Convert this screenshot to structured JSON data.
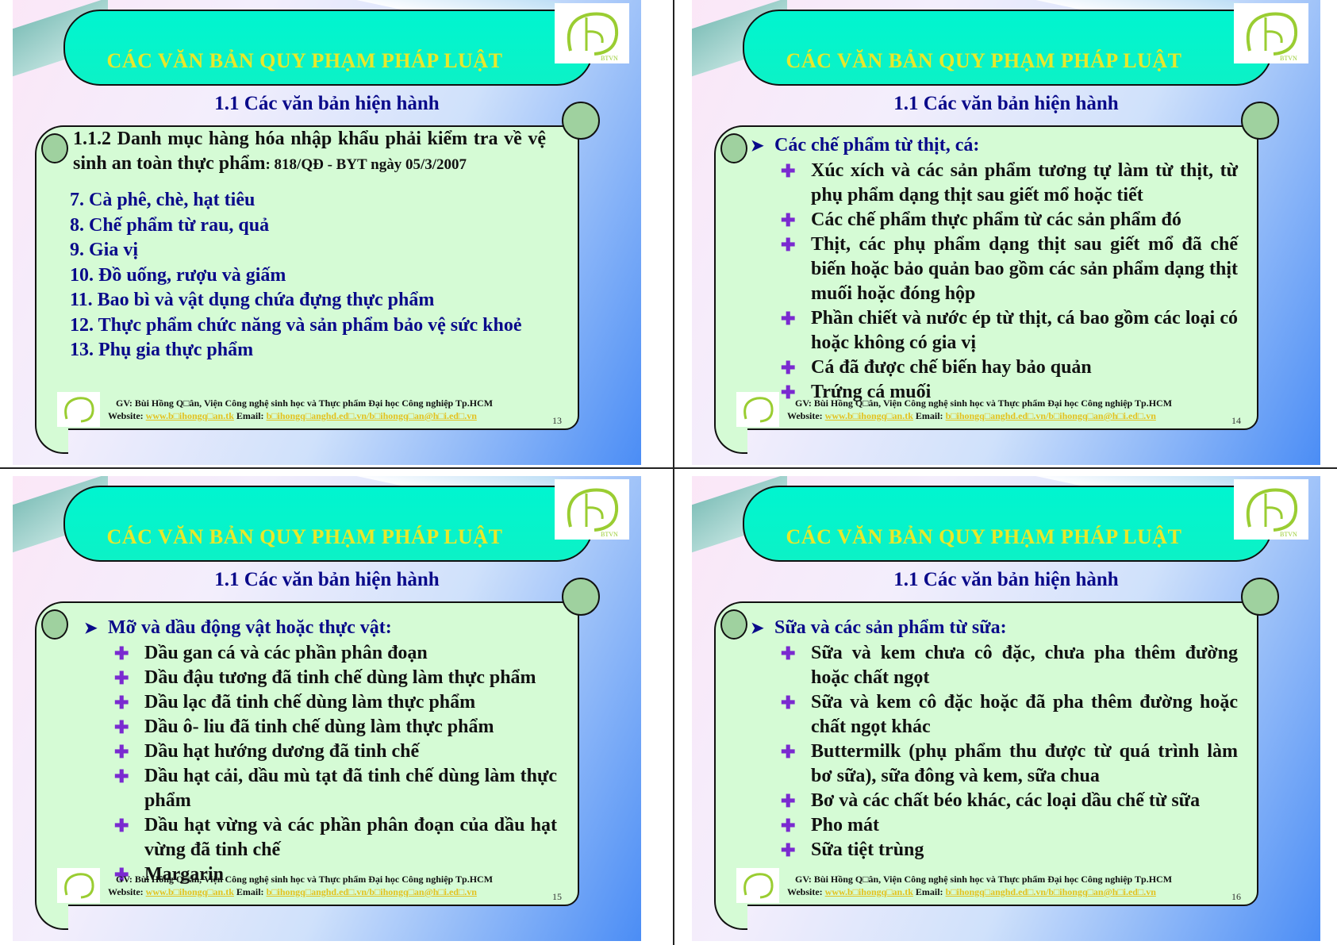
{
  "slides": [
    {
      "title": "CÁC VĂN BẢN QUY PHẠM PHÁP LUẬT",
      "subtitle": "1.1 Các văn bản hiện hành",
      "heading_main": "1.1.2  Danh mục hàng hóa nhập khẩu phải kiểm tra về vệ sinh an toàn thực phẩm",
      "heading_ref": ": 818/QĐ - BYT ngày 05/3/2007",
      "items": [
        "7. Cà phê, chè, hạt tiêu",
        "8. Chế phẩm từ rau, quả",
        "9. Gia vị",
        "10. Đồ uống, rượu và giấm",
        "11. Bao bì và vật dụng chứa đựng thực phẩm",
        "12. Thực phẩm chức năng và sản phẩm bảo vệ sức khoẻ",
        "13. Phụ gia thực phẩm"
      ],
      "footer_line1": "GV: Bùi Hồng Q□ân, Viện Công nghệ sinh học và Thực phẩm  Đại học Công nghiệp Tp.HCM",
      "footer_website_label": "Website: ",
      "footer_website": "www.b□ihongq□an.tk",
      "footer_email_label": "  Email: ",
      "footer_email": "b□ihongq□anghd.ed□.vn/b□ihongq□an@h□i.ed□.vn",
      "page": "13"
    },
    {
      "title": "CÁC VĂN BẢN QUY PHẠM PHÁP LUẬT",
      "subtitle": "1.1 Các văn bản hiện hành",
      "lead": "Các chế phẩm từ thịt, cá:",
      "bullets": [
        "Xúc xích và các sản phẩm tương tự làm từ thịt, từ phụ phẩm dạng thịt sau giết mổ hoặc tiết",
        "Các chế phẩm thực phẩm từ các sản phẩm đó",
        "Thịt, các phụ phẩm dạng thịt sau giết mổ đã chế biến hoặc bảo quản bao gồm các sản phẩm dạng thịt muối hoặc đóng hộp",
        "Phần chiết và nước ép từ thịt, cá bao gồm các loại có hoặc không có gia vị",
        "Cá đã được chế biến hay bảo quản",
        "Trứng cá muối"
      ],
      "footer_line1": "GV: Bùi Hồng Q□ân, Viện Công nghệ sinh học và Thực phẩm  Đại học Công nghiệp Tp.HCM",
      "footer_website_label": "Website: ",
      "footer_website": "www.b□ihongq□an.tk",
      "footer_email_label": "  Email: ",
      "footer_email": "b□ihongq□anghd.ed□.vn/b□ihongq□an@h□i.ed□.vn",
      "page": "14"
    },
    {
      "title": "CÁC VĂN BẢN QUY PHẠM PHÁP LUẬT",
      "subtitle": "1.1 Các văn bản hiện hành",
      "lead": "Mỡ và dầu động vật hoặc thực vật:",
      "bullets": [
        "Dầu gan cá và các phần phân đoạn",
        "Dầu đậu tương đã tinh chế dùng làm thực phẩm",
        "Dầu lạc đã tinh chế dùng làm thực phẩm",
        "Dầu ô- liu đã tinh chế dùng làm thực phẩm",
        "Dầu hạt hướng dương đã tinh chế",
        "Dầu hạt cải, dầu mù tạt đã tinh chế dùng làm thực phẩm",
        "Dầu hạt vừng và các phần phân đoạn của dầu hạt vừng đã tinh chế",
        "Margarin"
      ],
      "footer_line1": "GV: Bùi Hồng Q□ân, Viện Công nghệ sinh học và Thực phẩm  Đại học Công nghiệp Tp.HCM",
      "footer_website_label": "Website: ",
      "footer_website": "www.b□ihongq□an.tk",
      "footer_email_label": "  Email: ",
      "footer_email": "b□ihongq□anghd.ed□.vn/b□ihongq□an@h□i.ed□.vn",
      "page": "15"
    },
    {
      "title": "CÁC VĂN BẢN QUY PHẠM PHÁP LUẬT",
      "subtitle": "1.1 Các văn bản hiện hành",
      "lead": "Sữa và các sản phẩm từ sữa:",
      "bullets": [
        "Sữa và kem chưa cô đặc, chưa pha thêm đường hoặc chất ngọt",
        "Sữa và kem cô đặc hoặc đã pha thêm đường hoặc chất ngọt khác",
        "Buttermilk (phụ phẩm thu được từ quá trình làm bơ sữa), sữa đông và kem, sữa chua",
        "Bơ và các chất béo khác, các loại dầu chế từ sữa",
        "Pho mát",
        "Sữa tiệt trùng"
      ],
      "footer_line1": "GV: Bùi Hồng Q□ân, Viện Công nghệ sinh học và Thực phẩm  Đại học Công nghiệp Tp.HCM",
      "footer_website_label": "Website: ",
      "footer_website": "www.b□ihongq□an.tk",
      "footer_email_label": "  Email: ",
      "footer_email": "b□ihongq□anghd.ed□.vn/b□ihongq□an@h□i.ed□.vn",
      "page": "16"
    }
  ],
  "icons": {
    "bullet": "arrow-cross-bullet-icon",
    "lead": "chevron-arrow-icon",
    "logo": "institute-logo-icon"
  }
}
